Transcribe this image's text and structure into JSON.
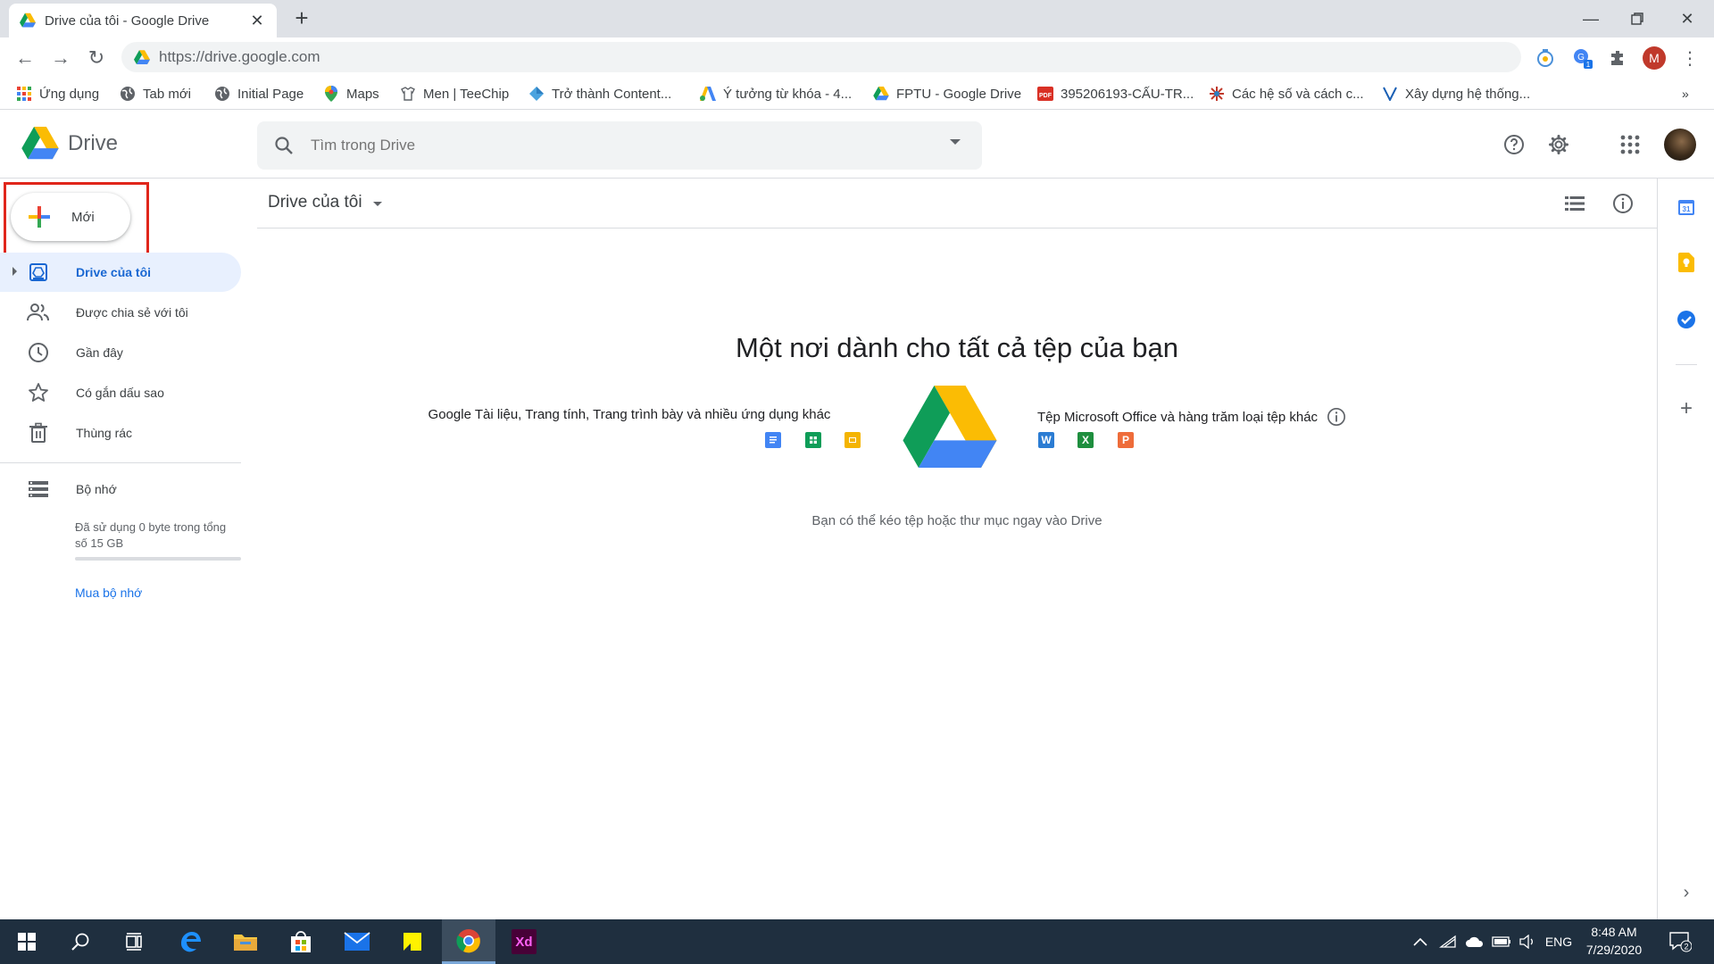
{
  "browser": {
    "tab_title": "Drive của tôi - Google Drive",
    "url": "https://drive.google.com"
  },
  "bookmarks": [
    {
      "label": "Ứng dụng",
      "icon": "apps-grid-icon"
    },
    {
      "label": "Tab mới",
      "icon": "globe-icon"
    },
    {
      "label": "Initial Page",
      "icon": "globe-icon"
    },
    {
      "label": "Maps",
      "icon": "maps-pin-icon"
    },
    {
      "label": "Men | TeeChip",
      "icon": "teechip-icon"
    },
    {
      "label": "Trở thành Content...",
      "icon": "diamond-icon"
    },
    {
      "label": "Ý tưởng từ khóa - 4...",
      "icon": "google-ads-icon"
    },
    {
      "label": "FPTU - Google Drive",
      "icon": "drive-icon"
    },
    {
      "label": "395206193-CẤU-TR...",
      "icon": "pdf-icon"
    },
    {
      "label": "Các hệ số và cách c...",
      "icon": "asterisk-icon"
    },
    {
      "label": "Xây dựng hệ thống...",
      "icon": "v-icon"
    }
  ],
  "drive": {
    "product_name": "Drive",
    "search_placeholder": "Tìm trong Drive",
    "new_button": "Mới",
    "nav": [
      {
        "label": "Drive của tôi",
        "active": true
      },
      {
        "label": "Được chia sẻ với tôi",
        "active": false
      },
      {
        "label": "Gần đây",
        "active": false
      },
      {
        "label": "Có gắn dấu sao",
        "active": false
      },
      {
        "label": "Thùng rác",
        "active": false
      }
    ],
    "storage": {
      "label": "Bộ nhớ",
      "usage_text": "Đã sử dụng 0 byte trong tổng số 15 GB",
      "used_fraction": 0,
      "buy_label": "Mua bộ nhớ"
    },
    "breadcrumb": "Drive của tôi",
    "empty_state": {
      "title": "Một nơi dành cho tất cả tệp của bạn",
      "left_text": "Google Tài liệu, Trang tính, Trang trình bày và nhiều ứng dụng khác",
      "right_text": "Tệp Microsoft Office và hàng trăm loại tệp khác",
      "drag_hint": "Bạn có thể kéo tệp hoặc thư mục ngay vào Drive",
      "office_letters": [
        "W",
        "X",
        "P"
      ]
    }
  },
  "side_panel": {
    "calendar_day": "31"
  },
  "profile_letter": "M",
  "extension_badge": "1",
  "taskbar": {
    "apps": [
      "start",
      "search",
      "task-view",
      "edge",
      "file-explorer",
      "store",
      "mail",
      "sticky-notes",
      "chrome",
      "adobe-xd"
    ],
    "xd_label": "Xd",
    "language": "ENG",
    "time": "8:48 AM",
    "date": "7/29/2020",
    "notification_count": "2"
  },
  "colors": {
    "accent_blue": "#1a73e8",
    "active_nav_bg": "#e8f0fe",
    "highlight_red": "#e0261b",
    "taskbar": "#1f2f3f"
  }
}
